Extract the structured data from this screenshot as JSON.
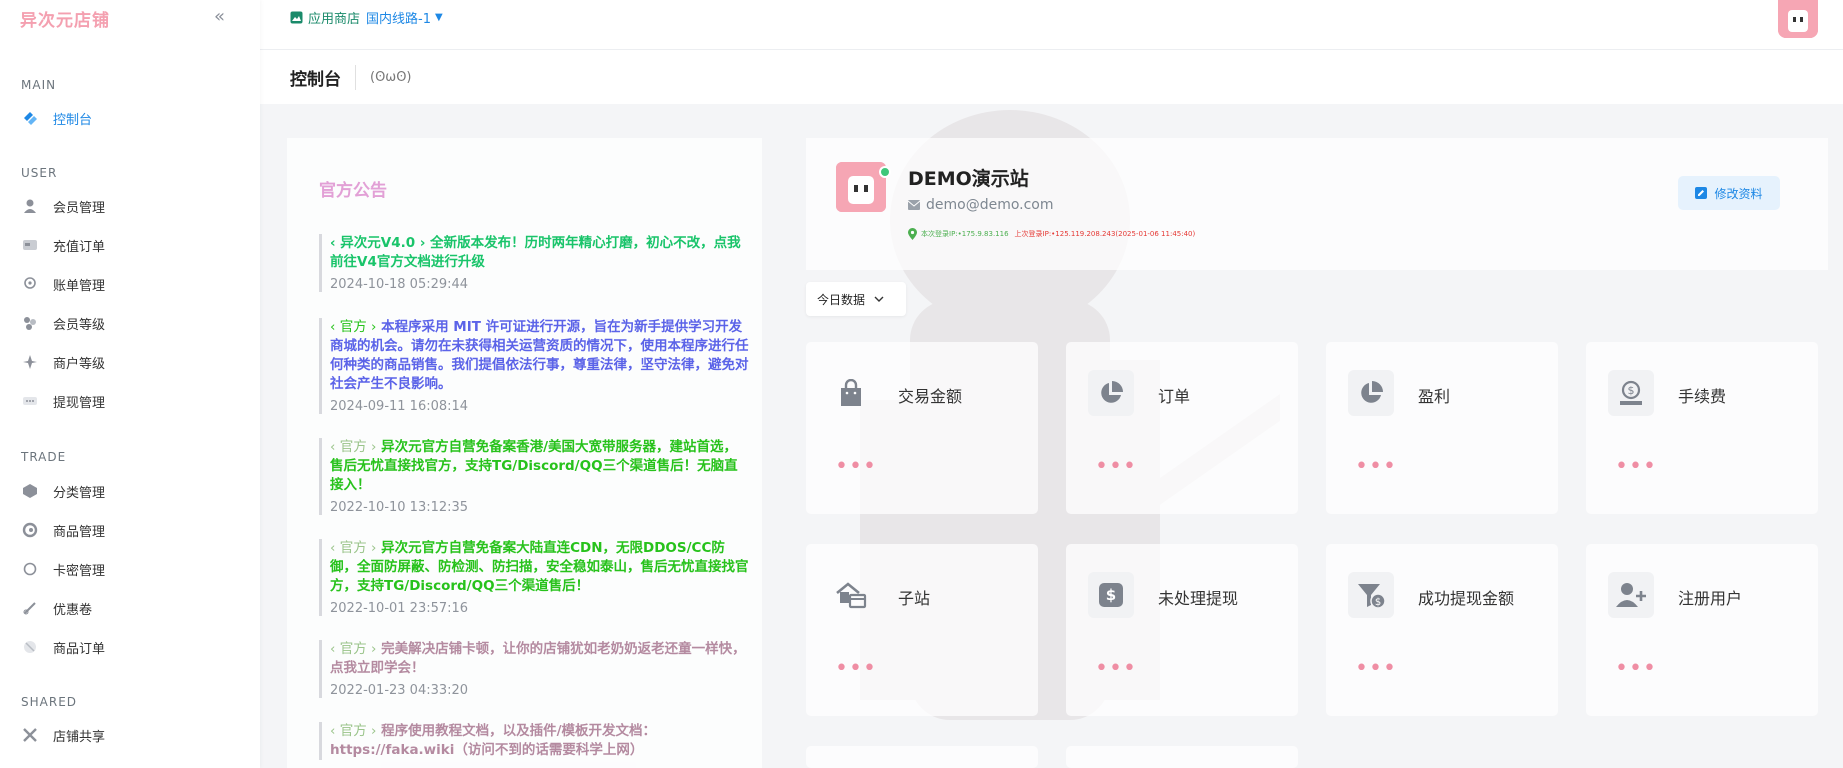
{
  "app": {
    "logo": "异次元店铺"
  },
  "sidebar": {
    "sections": [
      {
        "title": "MAIN",
        "items": [
          {
            "label": "控制台",
            "icon": "dashboard-icon",
            "active": true
          }
        ]
      },
      {
        "title": "USER",
        "items": [
          {
            "label": "会员管理",
            "icon": "user-icon"
          },
          {
            "label": "充值订单",
            "icon": "recharge-icon"
          },
          {
            "label": "账单管理",
            "icon": "bill-icon"
          },
          {
            "label": "会员等级",
            "icon": "level-icon"
          },
          {
            "label": "商户等级",
            "icon": "merchant-level-icon"
          },
          {
            "label": "提现管理",
            "icon": "withdraw-icon"
          }
        ]
      },
      {
        "title": "TRADE",
        "items": [
          {
            "label": "分类管理",
            "icon": "category-icon"
          },
          {
            "label": "商品管理",
            "icon": "goods-icon"
          },
          {
            "label": "卡密管理",
            "icon": "card-key-icon"
          },
          {
            "label": "优惠卷",
            "icon": "coupon-icon"
          },
          {
            "label": "商品订单",
            "icon": "order-icon"
          }
        ]
      },
      {
        "title": "SHARED",
        "items": [
          {
            "label": "店铺共享",
            "icon": "share-icon"
          }
        ]
      }
    ]
  },
  "topbar": {
    "store_label": "应用商店",
    "line_label": "国内线路-1"
  },
  "page": {
    "title": "控制台",
    "subtitle": "(ʘωʘ)"
  },
  "notices": {
    "title": "官方公告",
    "items": [
      {
        "tag": "‹ 异次元V4.0 ›",
        "text": "全新版本发布！历时两年精心打磨，初心不改，点我前往V4官方文档进行升级",
        "time": "2024-10-18 05:29:44",
        "color": "#19c46a"
      },
      {
        "tag": "‹ 官方 ›",
        "text": "本程序采用 MIT 许可证进行开源，旨在为新手提供学习开发商城的机会。请勿在未获得相关运营资质的情况下，使用本程序进行任何种类的商品销售。我们提倡依法行事，尊重法律，坚守法律，避免对社会产生不良影响。",
        "time": "2024-09-11 16:08:14",
        "color": "#5b63e8"
      },
      {
        "tag": "‹ 官方 ›",
        "text": "异次元官方自营免备案香港/美国大宽带服务器，建站首选，售后无忧直接找官方，支持TG/Discord/QQ三个渠道售后！无脑直接入！",
        "time": "2022-10-10 13:12:35",
        "color": "#27c21b"
      },
      {
        "tag": "‹ 官方 ›",
        "text": "异次元官方自营免备案大陆直连CDN，无限DDOS/CC防御，全面防屏蔽、防检测、防扫描，安全稳如泰山，售后无忧直接找官方，支持TG/Discord/QQ三个渠道售后！",
        "time": "2022-10-01 23:57:16",
        "color": "#27c21b"
      },
      {
        "tag": "‹ 官方 ›",
        "text": "完美解决店铺卡顿，让你的店铺犹如老奶奶返老还童一样快，点我立即学会！",
        "time": "2022-01-23 04:33:20",
        "color": "#b48aa0"
      },
      {
        "tag": "‹ 官方 ›",
        "text": "程序使用教程文档，以及插件/模板开发文档：https://faka.wiki（访问不到的话需要科学上网）",
        "time": "",
        "color": "#b48aa0"
      }
    ]
  },
  "profile": {
    "name": "DEMO演示站",
    "email": "demo@demo.com",
    "login_info": "本次登录IP:•175.9.83.116",
    "last_login": "上次登录IP:•125.119.208.243(2025-01-06 11:45:40)",
    "edit_label": "修改资料"
  },
  "filter": {
    "selected": "今日数据"
  },
  "stats": [
    {
      "label": "交易金额",
      "icon": "shopping-bag-icon",
      "value": "•••"
    },
    {
      "label": "订单",
      "icon": "pie-chart-icon",
      "value": "•••"
    },
    {
      "label": "盈利",
      "icon": "pie-chart-icon",
      "value": "•••"
    },
    {
      "label": "手续费",
      "icon": "money-hand-icon",
      "value": "•••"
    },
    {
      "label": "子站",
      "icon": "house-icon",
      "value": "•••"
    },
    {
      "label": "未处理提现",
      "icon": "dollar-badge-icon",
      "value": "•••"
    },
    {
      "label": "成功提现金额",
      "icon": "funnel-dollar-icon",
      "value": "•••"
    },
    {
      "label": "注册用户",
      "icon": "user-plus-icon",
      "value": "•••"
    }
  ],
  "colors": {
    "accent": "#1e88e5",
    "logo": "#f4a0b0",
    "notice_title": "#e2a0d6",
    "dots": "#ef8ea4"
  }
}
